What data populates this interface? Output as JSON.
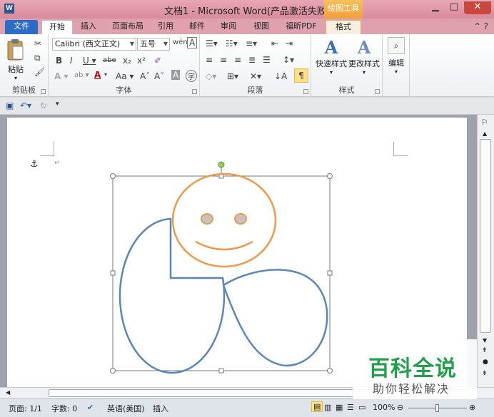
{
  "window": {
    "title": "文档1 - Microsoft Word(产品激活失败)",
    "icon": "W",
    "contextual_tab_group": "绘图工具",
    "controls": [
      "▁",
      "□",
      "✕"
    ]
  },
  "tabs": [
    "文件",
    "开始",
    "插入",
    "页面布局",
    "引用",
    "邮件",
    "审阅",
    "视图",
    "福昕PDF",
    "格式"
  ],
  "ribbon": {
    "clipboard": {
      "paste_label": "粘贴",
      "group_label": "剪贴板"
    },
    "font": {
      "font_name": "Calibri (西文正文)",
      "font_size": "五号",
      "group_label": "字体"
    },
    "paragraph": {
      "group_label": "段落"
    },
    "styles": {
      "quick_styles_label": "快速样式",
      "change_styles_label": "更改样式",
      "group_label": "样式"
    },
    "editing": {
      "label": "编辑"
    }
  },
  "status_bar": {
    "page": "页面: 1/1",
    "words": "字数: 0",
    "language": "英语(美国)",
    "mode": "插入",
    "zoom": "100%"
  },
  "watermark": {
    "main": "百科全说",
    "sub": "助你轻松解决"
  },
  "colors": {
    "title_bar": "#e8a6b4",
    "file_tab": "#2a6cc6",
    "contextual_tab": "#f0a03a",
    "shape_blue": "#5a86b8",
    "smiley_orange": "#ee9a4a",
    "eye_fill": "#c3c3c3",
    "watermark_green": "#20a04a"
  }
}
